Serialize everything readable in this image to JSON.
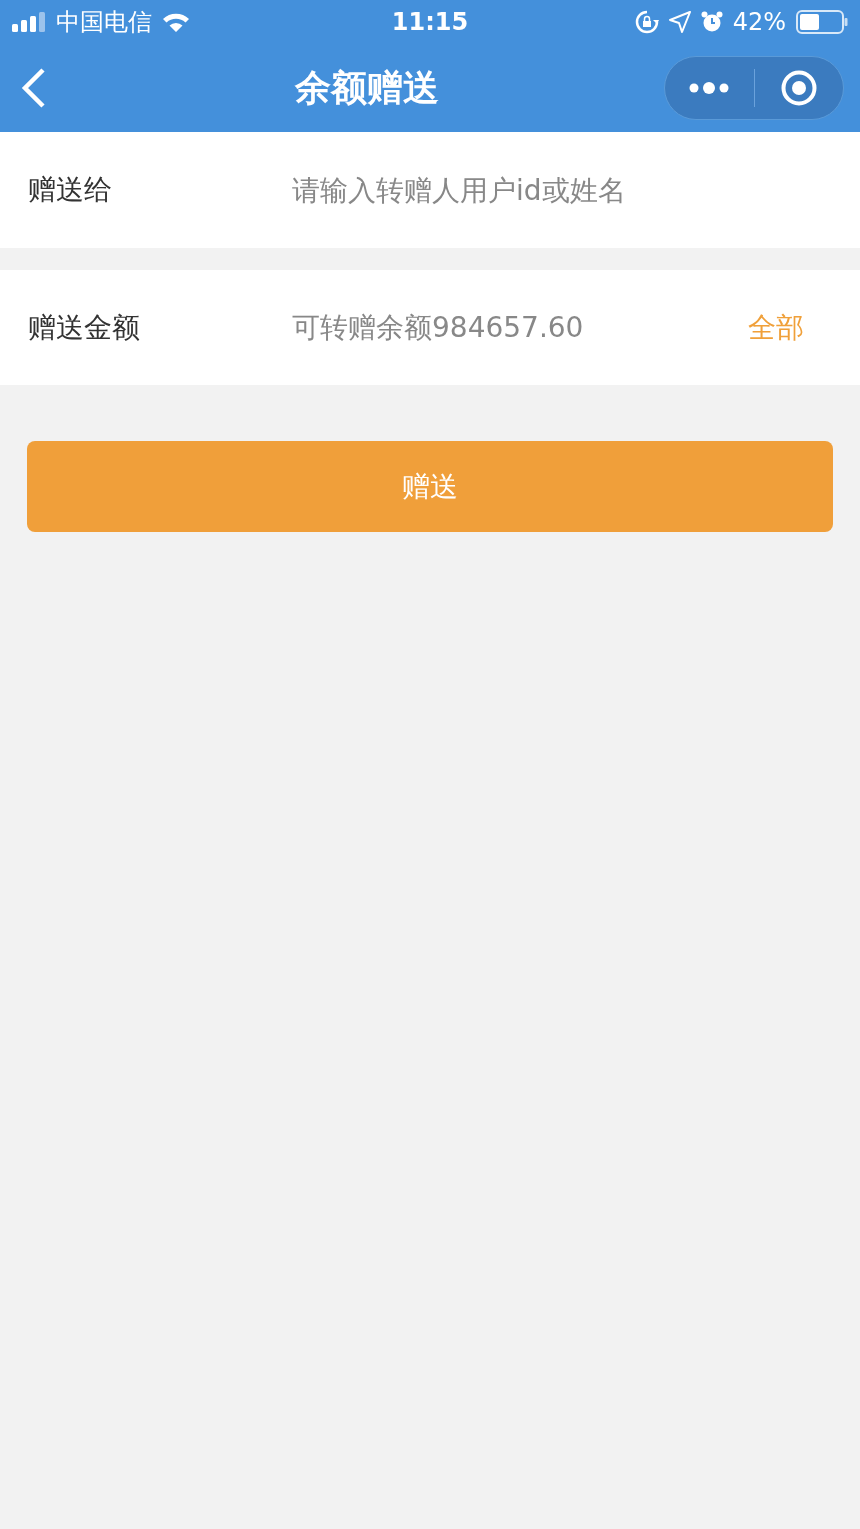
{
  "status_bar": {
    "carrier": "中国电信",
    "time": "11:15",
    "battery": "42%"
  },
  "nav_bar": {
    "title": "余额赠送"
  },
  "form": {
    "fields": [
      {
        "label": "赠送给",
        "placeholder": "请输入转赠人用户id或姓名"
      },
      {
        "label": "赠送金额",
        "placeholder": "可转赠余额984657.60",
        "action": "全部"
      }
    ]
  },
  "submit_button": "赠送"
}
